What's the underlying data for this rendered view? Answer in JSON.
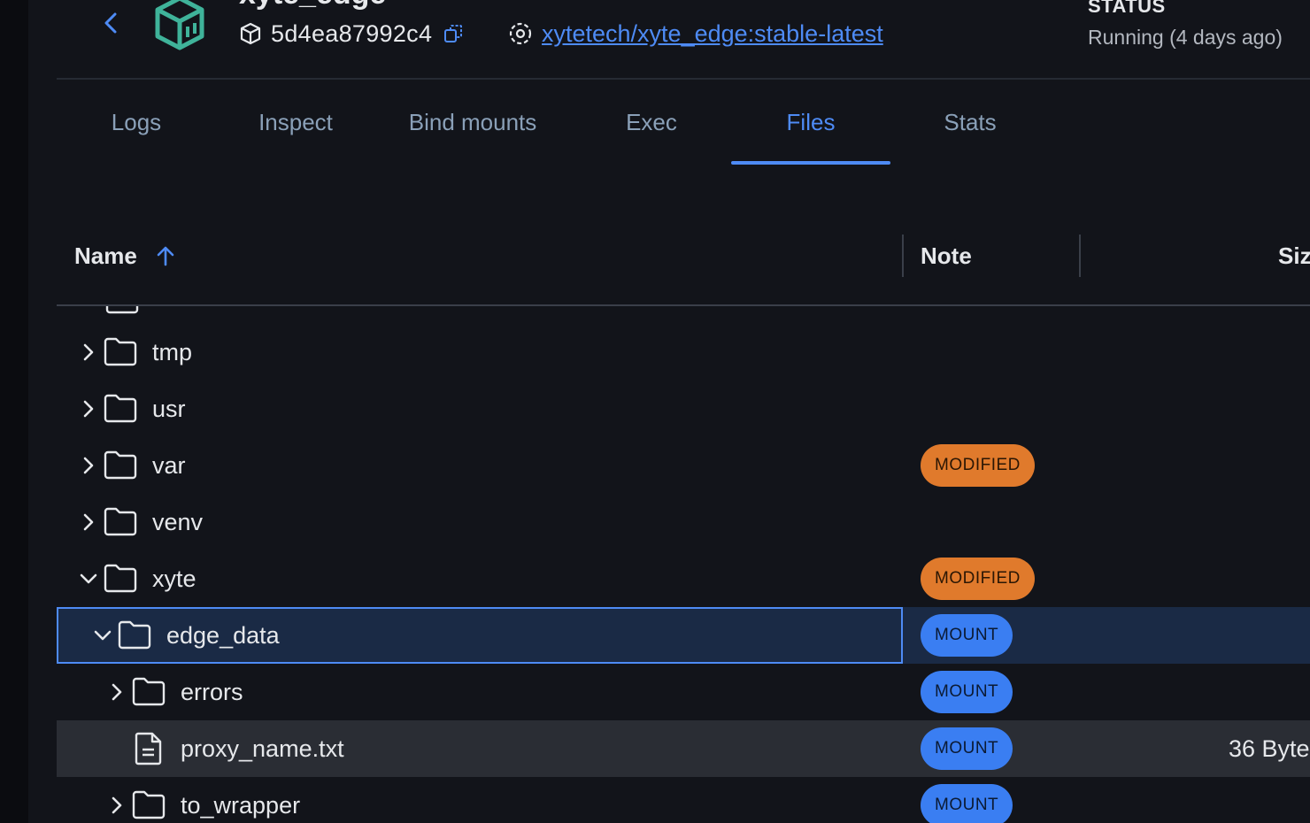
{
  "header": {
    "container_name": "xyte_edge",
    "container_id": "5d4ea87992c4",
    "image": "xytetech/xyte_edge:stable-latest",
    "status_label": "STATUS",
    "status_value": "Running (4 days ago)"
  },
  "tabs": [
    {
      "label": "Logs",
      "active": false
    },
    {
      "label": "Inspect",
      "active": false
    },
    {
      "label": "Bind mounts",
      "active": false
    },
    {
      "label": "Exec",
      "active": false
    },
    {
      "label": "Files",
      "active": true
    },
    {
      "label": "Stats",
      "active": false
    }
  ],
  "table": {
    "columns": {
      "name": "Name",
      "note": "Note",
      "size": "Siz"
    },
    "sort": "ascending"
  },
  "rows": [
    {
      "name": "tmp",
      "type": "folder",
      "expanded": false,
      "depth": 0,
      "note": "",
      "size": ""
    },
    {
      "name": "usr",
      "type": "folder",
      "expanded": false,
      "depth": 0,
      "note": "",
      "size": ""
    },
    {
      "name": "var",
      "type": "folder",
      "expanded": false,
      "depth": 0,
      "note": "MODIFIED",
      "size": ""
    },
    {
      "name": "venv",
      "type": "folder",
      "expanded": false,
      "depth": 0,
      "note": "",
      "size": ""
    },
    {
      "name": "xyte",
      "type": "folder",
      "expanded": true,
      "depth": 0,
      "note": "MODIFIED",
      "size": ""
    },
    {
      "name": "edge_data",
      "type": "folder",
      "expanded": true,
      "depth": 1,
      "note": "MOUNT",
      "size": "",
      "selected": true
    },
    {
      "name": "errors",
      "type": "folder",
      "expanded": false,
      "depth": 2,
      "note": "MOUNT",
      "size": ""
    },
    {
      "name": "proxy_name.txt",
      "type": "file",
      "depth": 2,
      "note": "MOUNT",
      "size": "36 Byte",
      "hovered": true
    },
    {
      "name": "to_wrapper",
      "type": "folder",
      "expanded": false,
      "depth": 2,
      "note": "MOUNT",
      "size": ""
    }
  ],
  "colors": {
    "accent": "#4e8bf5",
    "modified_badge": "#e07a2c",
    "mount_badge": "#3a7ef2",
    "icon_teal": "#3fb39a"
  },
  "icons": {
    "back": "chevron-left-icon",
    "container": "container-box-icon",
    "id": "cube-icon",
    "copy": "copy-icon",
    "image": "image-layers-icon",
    "sort": "arrow-up-icon",
    "folder": "folder-icon",
    "file": "file-text-icon",
    "expand": "chevron-right-icon",
    "collapse": "chevron-down-icon"
  }
}
